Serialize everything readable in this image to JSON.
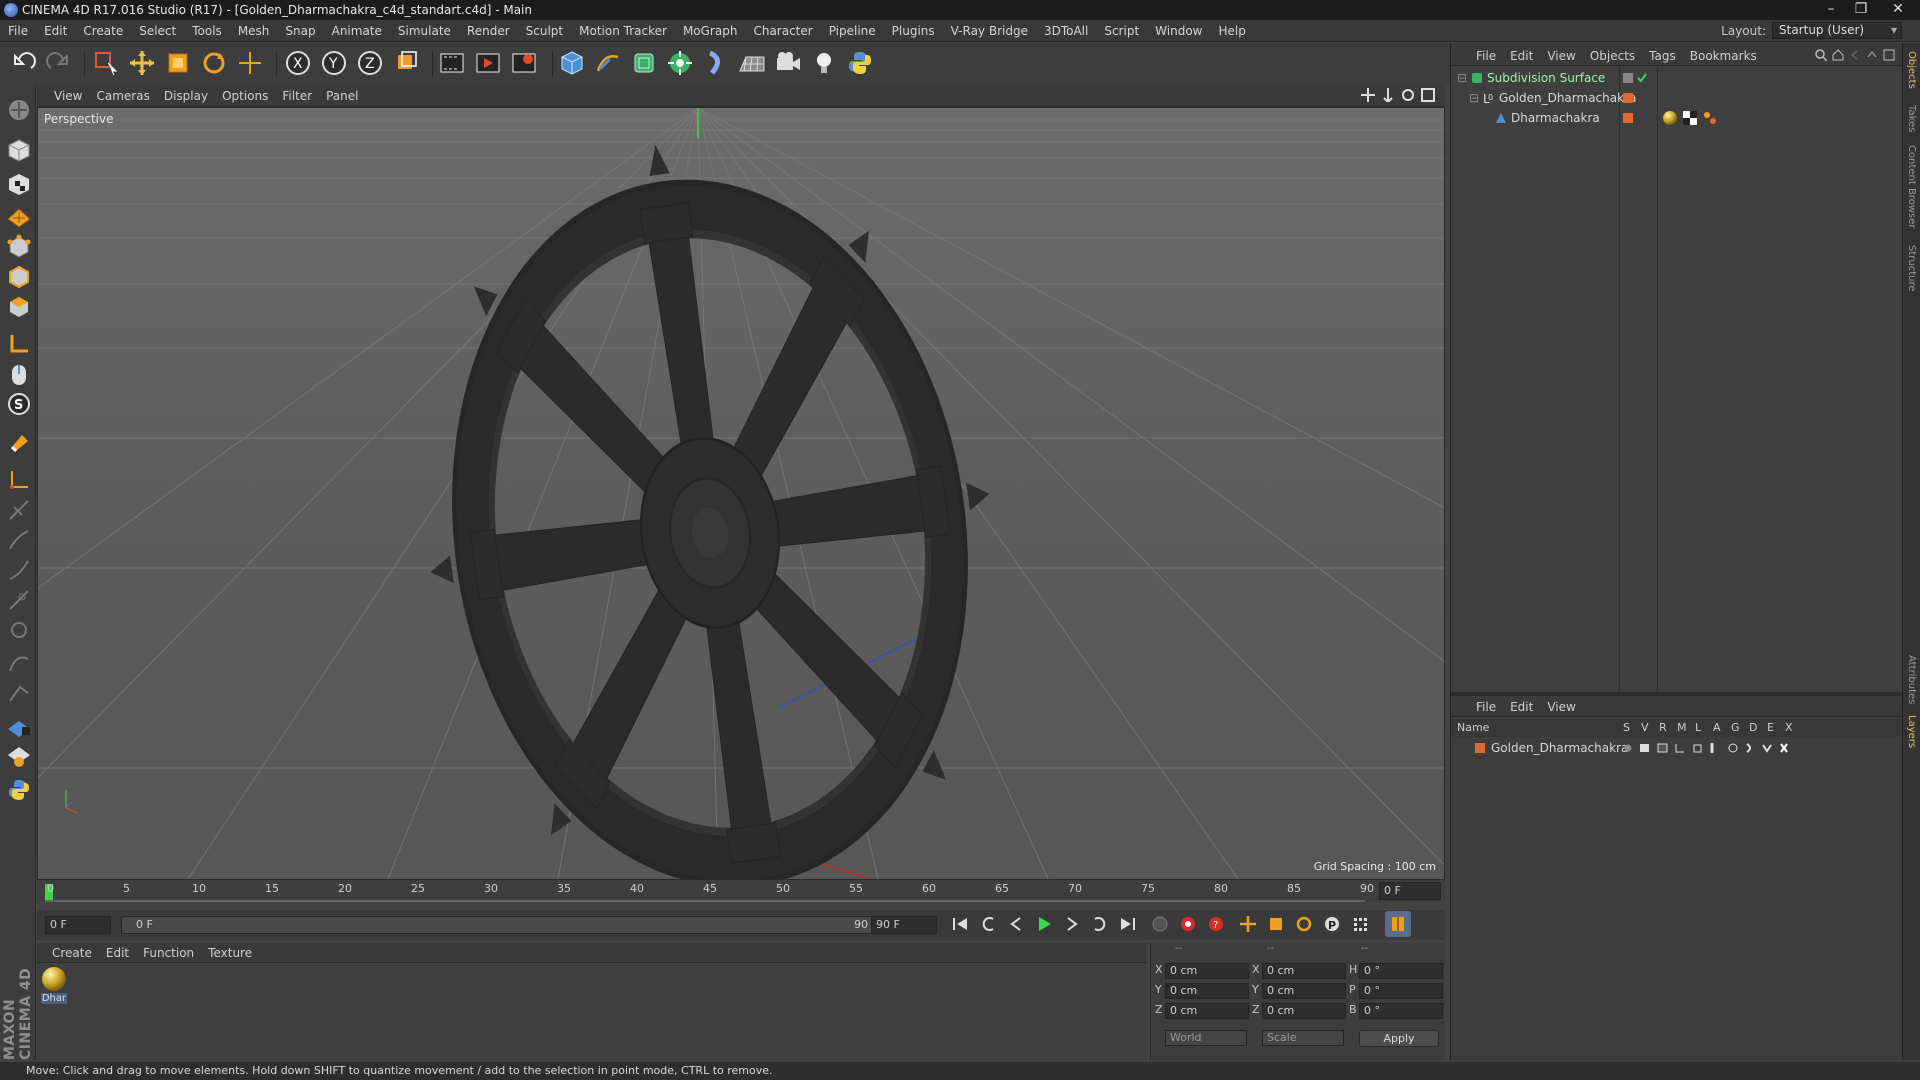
{
  "window": {
    "title": "CINEMA 4D R17.016 Studio (R17) - [Golden_Dharmachakra_c4d_standart.c4d] - Main",
    "controls": [
      "–",
      "❐",
      "✕"
    ]
  },
  "menu": [
    "File",
    "Edit",
    "Create",
    "Select",
    "Tools",
    "Mesh",
    "Snap",
    "Animate",
    "Simulate",
    "Render",
    "Sculpt",
    "Motion Tracker",
    "MoGraph",
    "Character",
    "Pipeline",
    "Plugins",
    "V-Ray Bridge",
    "3DToAll",
    "Script",
    "Window",
    "Help"
  ],
  "layout": {
    "label": "Layout:",
    "value": "Startup (User)"
  },
  "viewport": {
    "menu": [
      "View",
      "Cameras",
      "Display",
      "Options",
      "Filter",
      "Panel"
    ],
    "label": "Perspective",
    "grid_info": "Grid Spacing : 100 cm"
  },
  "timeline": {
    "ticks": [
      "0",
      "5",
      "10",
      "15",
      "20",
      "25",
      "30",
      "35",
      "40",
      "45",
      "50",
      "55",
      "60",
      "65",
      "70",
      "75",
      "80",
      "85",
      "90"
    ],
    "current_frame": "0 F",
    "start_field": "0 F",
    "range_start": "0 F",
    "range_end": "90 F",
    "end_field": "90 F"
  },
  "materials": {
    "menu": [
      "Create",
      "Edit",
      "Function",
      "Texture"
    ],
    "items": [
      {
        "name": "Dhar"
      }
    ]
  },
  "coords": {
    "headers": [
      "--",
      "--",
      "--"
    ],
    "rows": [
      {
        "a": "X",
        "av": "0 cm",
        "b": "X",
        "bv": "0 cm",
        "c": "H",
        "cv": "0 °"
      },
      {
        "a": "Y",
        "av": "0 cm",
        "b": "Y",
        "bv": "0 cm",
        "c": "P",
        "cv": "0 °"
      },
      {
        "a": "Z",
        "av": "0 cm",
        "b": "Z",
        "bv": "0 cm",
        "c": "B",
        "cv": "0 °"
      }
    ],
    "space": "World",
    "mode": "Scale",
    "apply": "Apply"
  },
  "objects_panel": {
    "menu": [
      "File",
      "Edit",
      "View",
      "Objects",
      "Tags",
      "Bookmarks"
    ],
    "items": [
      {
        "name": "Subdivision Surface",
        "indent": 0
      },
      {
        "name": "Golden_Dharmachakra",
        "indent": 1
      },
      {
        "name": "Dharmachakra",
        "indent": 2
      }
    ]
  },
  "layers_panel": {
    "menu": [
      "File",
      "Edit",
      "View"
    ],
    "columns": [
      "Name",
      "S",
      "V",
      "R",
      "M",
      "L",
      "A",
      "G",
      "D",
      "E",
      "X"
    ],
    "items": [
      {
        "name": "Golden_Dharmachakra"
      }
    ]
  },
  "right_tabs": [
    "Objects",
    "Takes",
    "Content Browser",
    "Structure",
    "Attributes",
    "Layers"
  ],
  "status": "Move: Click and drag to move elements. Hold down SHIFT to quantize movement / add to the selection in point mode, CTRL to remove.",
  "brand": "MAXON CINEMA 4D",
  "colors": {
    "accent_blue": "#4a90d9",
    "layer_orange": "#e06a2a",
    "play_green": "#3cd64a"
  }
}
